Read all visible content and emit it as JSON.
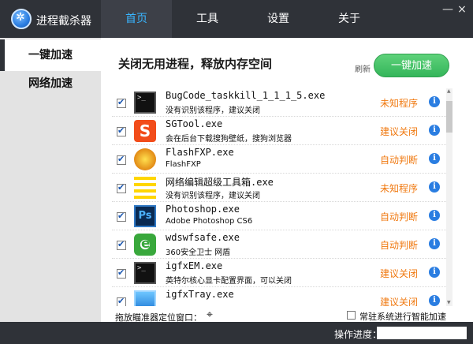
{
  "app": {
    "title": "进程截杀器"
  },
  "nav": {
    "tabs": [
      {
        "label": "首页"
      },
      {
        "label": "工具"
      },
      {
        "label": "设置"
      },
      {
        "label": "关于"
      }
    ]
  },
  "window": {
    "minimize": "—",
    "close": "×"
  },
  "sidebar": {
    "items": [
      {
        "label": "一键加速"
      },
      {
        "label": "网络加速"
      }
    ]
  },
  "main": {
    "heading": "关闭无用进程，释放内存空间",
    "refresh": "刷新",
    "accelerate_button": "一键加速",
    "processes": [
      {
        "name": "BugCode_taskkill_1_1_1_5.exe",
        "desc": "没有识别该程序，建议关闭",
        "status": "未知程序",
        "icon": "console-icon"
      },
      {
        "name": "SGTool.exe",
        "desc": "会在后台下载搜狗壁纸，搜狗浏览器",
        "status": "建议关闭",
        "icon": "sogou-icon"
      },
      {
        "name": "FlashFXP.exe",
        "desc": "FlashFXP",
        "status": "自动判断",
        "icon": "flashfxp-icon"
      },
      {
        "name": "网络编辑超级工具箱.exe",
        "desc": "没有识别该程序，建议关闭",
        "status": "未知程序",
        "icon": "toolbox-icon"
      },
      {
        "name": "Photoshop.exe",
        "desc": "Adobe Photoshop CS6",
        "status": "自动判断",
        "icon": "photoshop-icon"
      },
      {
        "name": "wdswfsafe.exe",
        "desc": "360安全卫士 网盾",
        "status": "自动判断",
        "icon": "360-safe-icon"
      },
      {
        "name": "igfxEM.exe",
        "desc": "英特尔核心显卡配置界面，可以关闭",
        "status": "建议关闭",
        "icon": "console-icon"
      },
      {
        "name": "igfxTray.exe",
        "desc": "",
        "status": "建议关闭",
        "icon": "intel-tray-icon"
      }
    ],
    "drag_label": "拖放瞄准器定位窗口：",
    "smart_label": "常驻系统进行智能加速"
  },
  "status": {
    "progress_label": "操作进度：",
    "progress_percent": 0
  },
  "colors": {
    "accent": "#39b5ff",
    "status_orange": "#f07a12",
    "button_green": "#34b65a"
  }
}
